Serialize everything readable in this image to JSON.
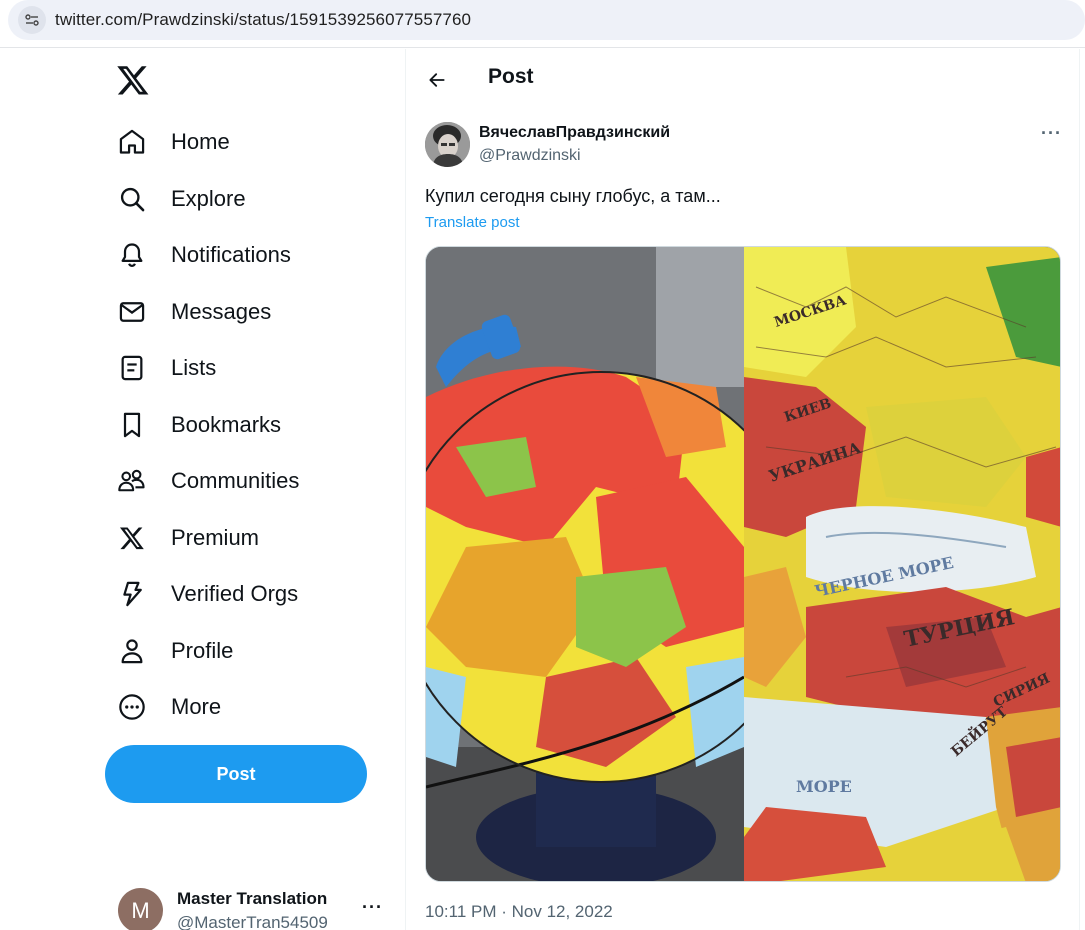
{
  "browser": {
    "url": "twitter.com/Prawdzinski/status/1591539256077557760"
  },
  "sidebar": {
    "logo_icon": "x-logo-icon",
    "items": [
      {
        "label": "Home",
        "icon": "home-icon"
      },
      {
        "label": "Explore",
        "icon": "search-icon"
      },
      {
        "label": "Notifications",
        "icon": "bell-icon"
      },
      {
        "label": "Messages",
        "icon": "envelope-icon"
      },
      {
        "label": "Lists",
        "icon": "list-icon"
      },
      {
        "label": "Bookmarks",
        "icon": "bookmark-icon"
      },
      {
        "label": "Communities",
        "icon": "people-icon"
      },
      {
        "label": "Premium",
        "icon": "x-logo-icon"
      },
      {
        "label": "Verified Orgs",
        "icon": "lightning-icon"
      },
      {
        "label": "Profile",
        "icon": "person-icon"
      },
      {
        "label": "More",
        "icon": "more-circle-icon"
      }
    ],
    "post_button_label": "Post",
    "account": {
      "avatar_letter": "M",
      "name": "Master Translation",
      "handle": "@MasterTran54509",
      "more": "···"
    }
  },
  "main": {
    "header_title": "Post",
    "post": {
      "author_name": "ВячеславПравдзинский",
      "author_handle": "@Prawdzinski",
      "more": "···",
      "text": "Купил сегодня сыну глобус, а там...",
      "translate_label": "Translate post",
      "timestamp": "10:11 PM · Nov 12, 2022",
      "media_labels": [
        "МОСКВА",
        "ЧЕРНОЕ МОРЕ",
        "УКРАИНА",
        "ТУРЦИЯ",
        "СИРИЯ",
        "КИЕВ",
        "МОРЕ",
        "БЕЙРУТ"
      ]
    }
  },
  "colors": {
    "accent": "#1d9bf0",
    "text_primary": "#0f1419",
    "text_secondary": "#536471"
  }
}
